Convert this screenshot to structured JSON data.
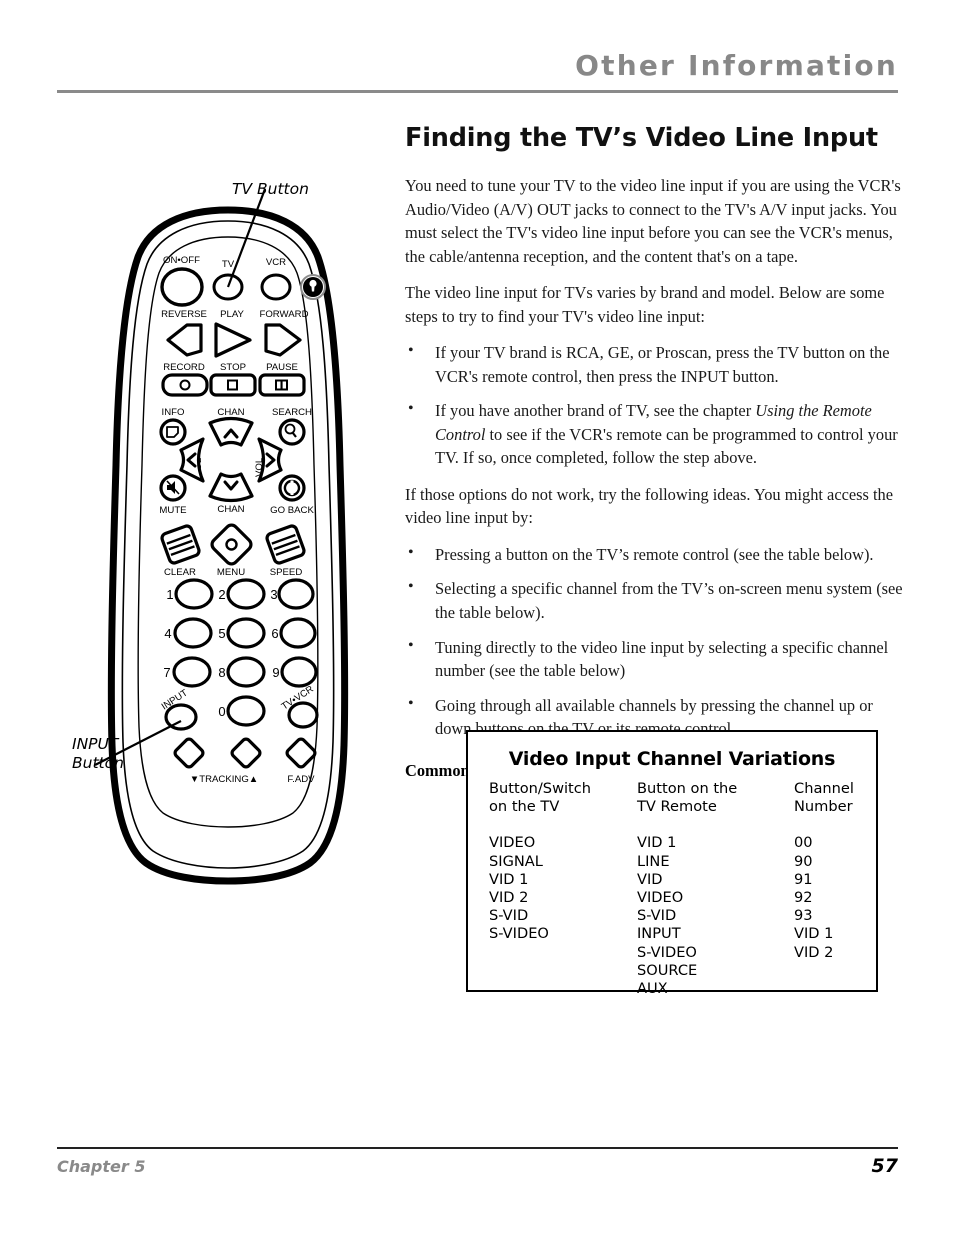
{
  "header": {
    "running_head": "Other Information"
  },
  "main": {
    "title": "Finding the TV’s Video Line Input",
    "para1": "You need to tune your TV to the video line input if you are using the VCR's Audio/Video (A/V) OUT jacks to connect to the TV's A/V input jacks. You must select the TV's video line input before you can see the VCR's menus, the cable/antenna reception, and the content that's on a tape.",
    "para2": "The video line input for TVs varies by brand and model. Below are some steps to try to find your TV's video line input:",
    "bullets_a": [
      {
        "pre": "If your TV brand is RCA, GE, or Proscan, press the TV button on the VCR's remote control, then press the INPUT button.",
        "italic": "",
        "post": ""
      },
      {
        "pre": "If you have another brand of TV, see the chapter ",
        "italic": "Using the Remote Control",
        "post": " to see if the VCR's remote can be programmed to control your TV. If so, once completed, follow the step above."
      }
    ],
    "para3": "If those options do not work, try the following ideas. You might access the video line input by:",
    "bullets_b": [
      "Pressing a button on the TV’s remote control (see the table below).",
      "Selecting a specific channel from the TV’s on-screen menu system (see the table below).",
      "Tuning directly to the video line input by selecting a specific channel number (see the table below)",
      "Going through all available channels by pressing the channel up or down buttons on the TV or its remote control."
    ],
    "scenarios_label": "Common Video Line Input scenarios:",
    "bullet_glyph": "•"
  },
  "table": {
    "title": "Video Input Channel Variations",
    "headers": {
      "col_a_line1": "Button/Switch",
      "col_a_line2": "on the TV",
      "col_b_line1": "Button on the",
      "col_b_line2": "TV Remote",
      "col_c_line1": "Channel",
      "col_c_line2": "Number"
    },
    "col_a": [
      "VIDEO",
      "SIGNAL",
      "VID 1",
      "VID 2",
      "S-VID",
      "S-VIDEO"
    ],
    "col_b": [
      "VID 1",
      "LINE",
      "VID",
      "VIDEO",
      "S-VID",
      "INPUT",
      "S-VIDEO",
      "SOURCE",
      "AUX"
    ],
    "col_c": [
      "00",
      "90",
      "91",
      "92",
      "93",
      "VID 1",
      "VID 2"
    ]
  },
  "callouts": {
    "tv_button": "TV Button",
    "input_button": "INPUT\nButton"
  },
  "remote": {
    "top_row": [
      "ON•OFF",
      "TV",
      "VCR"
    ],
    "transport_row": [
      "REVERSE",
      "PLAY",
      "FORWARD"
    ],
    "record_row": [
      "RECORD",
      "STOP",
      "PAUSE"
    ],
    "info_label": "INFO",
    "search_label": "SEARCH",
    "chan_up_label": "CHAN",
    "chan_down_label": "CHAN",
    "vol_left_label": "VOL",
    "vol_right_label": "VOL",
    "mute_label": "MUTE",
    "goback_label": "GO BACK",
    "shape_row": [
      "CLEAR",
      "MENU",
      "SPEED"
    ],
    "keypad": [
      "1",
      "2",
      "3",
      "4",
      "5",
      "6",
      "7",
      "8",
      "9",
      "0"
    ],
    "input_label": "INPUT",
    "tvvcr_label": "TV•VCR",
    "tracking_label": "▼TRACKING▲",
    "fadv_label": "F.ADV"
  },
  "footer": {
    "chapter": "Chapter 5",
    "page_number": "57"
  },
  "colors": {
    "running_head": "#888888",
    "rule": "#8a8a8a",
    "text": "#1a1a1a",
    "page_number": "#000000"
  }
}
